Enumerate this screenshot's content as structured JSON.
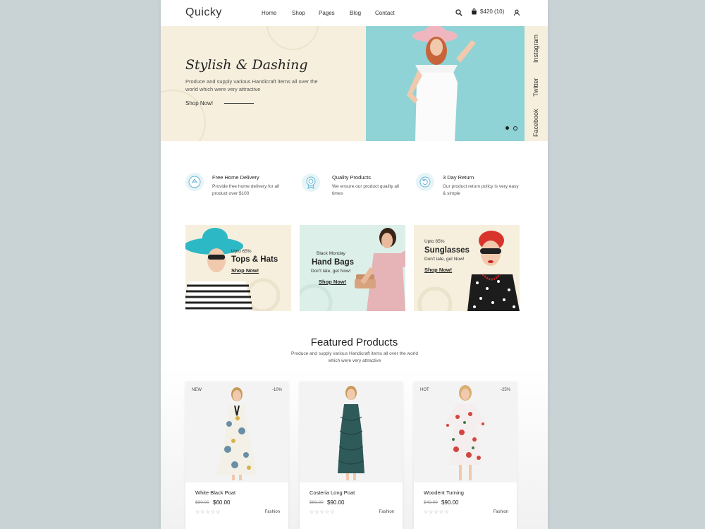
{
  "header": {
    "logo": "Quicky",
    "nav": [
      "Home",
      "Shop",
      "Pages",
      "Blog",
      "Contact"
    ],
    "cart_label": "$420 (10)"
  },
  "hero": {
    "title": "Stylish & Dashing",
    "description": "Produce and supply various Handicraft items all over the world which were very attractive",
    "cta": "Shop Now!",
    "social": [
      "Instagram",
      "Twitter",
      "Facebook"
    ]
  },
  "features": [
    {
      "title": "Free Home Delivery",
      "desc": "Provide free home delivery for all product over $100"
    },
    {
      "title": "Quality Products",
      "desc": "We ensure our product quality all times"
    },
    {
      "title": "3 Day Return",
      "desc": "Our product return policy is very easy & simple"
    }
  ],
  "promos": [
    {
      "small": "Upto 65%",
      "title": "Tops & Hats",
      "link": "Shop Now!",
      "sub": ""
    },
    {
      "small": "Black Monday",
      "title": "Hand Bags",
      "sub": "Don't late, get Now!",
      "link": "Shop Now!"
    },
    {
      "small": "Upto 65%",
      "title": "Sunglasses",
      "sub": "Don't late, get Now!",
      "link": "Shop Now!"
    }
  ],
  "featured": {
    "title": "Featured Products",
    "desc": "Produce and supply various Handicraft items all over the world which were very attractive"
  },
  "products": [
    {
      "badge_left": "NEW",
      "badge_right": "-10%",
      "name": "White Black Poat",
      "old_price": "$80.00",
      "price": "$60.00",
      "stars": "☆☆☆☆☆",
      "category": "Fashion"
    },
    {
      "badge_left": "",
      "badge_right": "",
      "name": "Costeria Long Poat",
      "old_price": "$60.00",
      "price": "$90.00",
      "stars": "☆☆☆☆☆",
      "category": "Fashion"
    },
    {
      "badge_left": "HOT",
      "badge_right": "-25%",
      "name": "Woodent Turning",
      "old_price": "$40.00",
      "price": "$90.00",
      "stars": "☆☆☆☆☆",
      "category": "Fashion"
    }
  ],
  "colors": {
    "outer_bg": "#c9d2d4",
    "cream": "#f6efdd",
    "mint": "#dcefe9",
    "sky": "#8fd3d6"
  }
}
